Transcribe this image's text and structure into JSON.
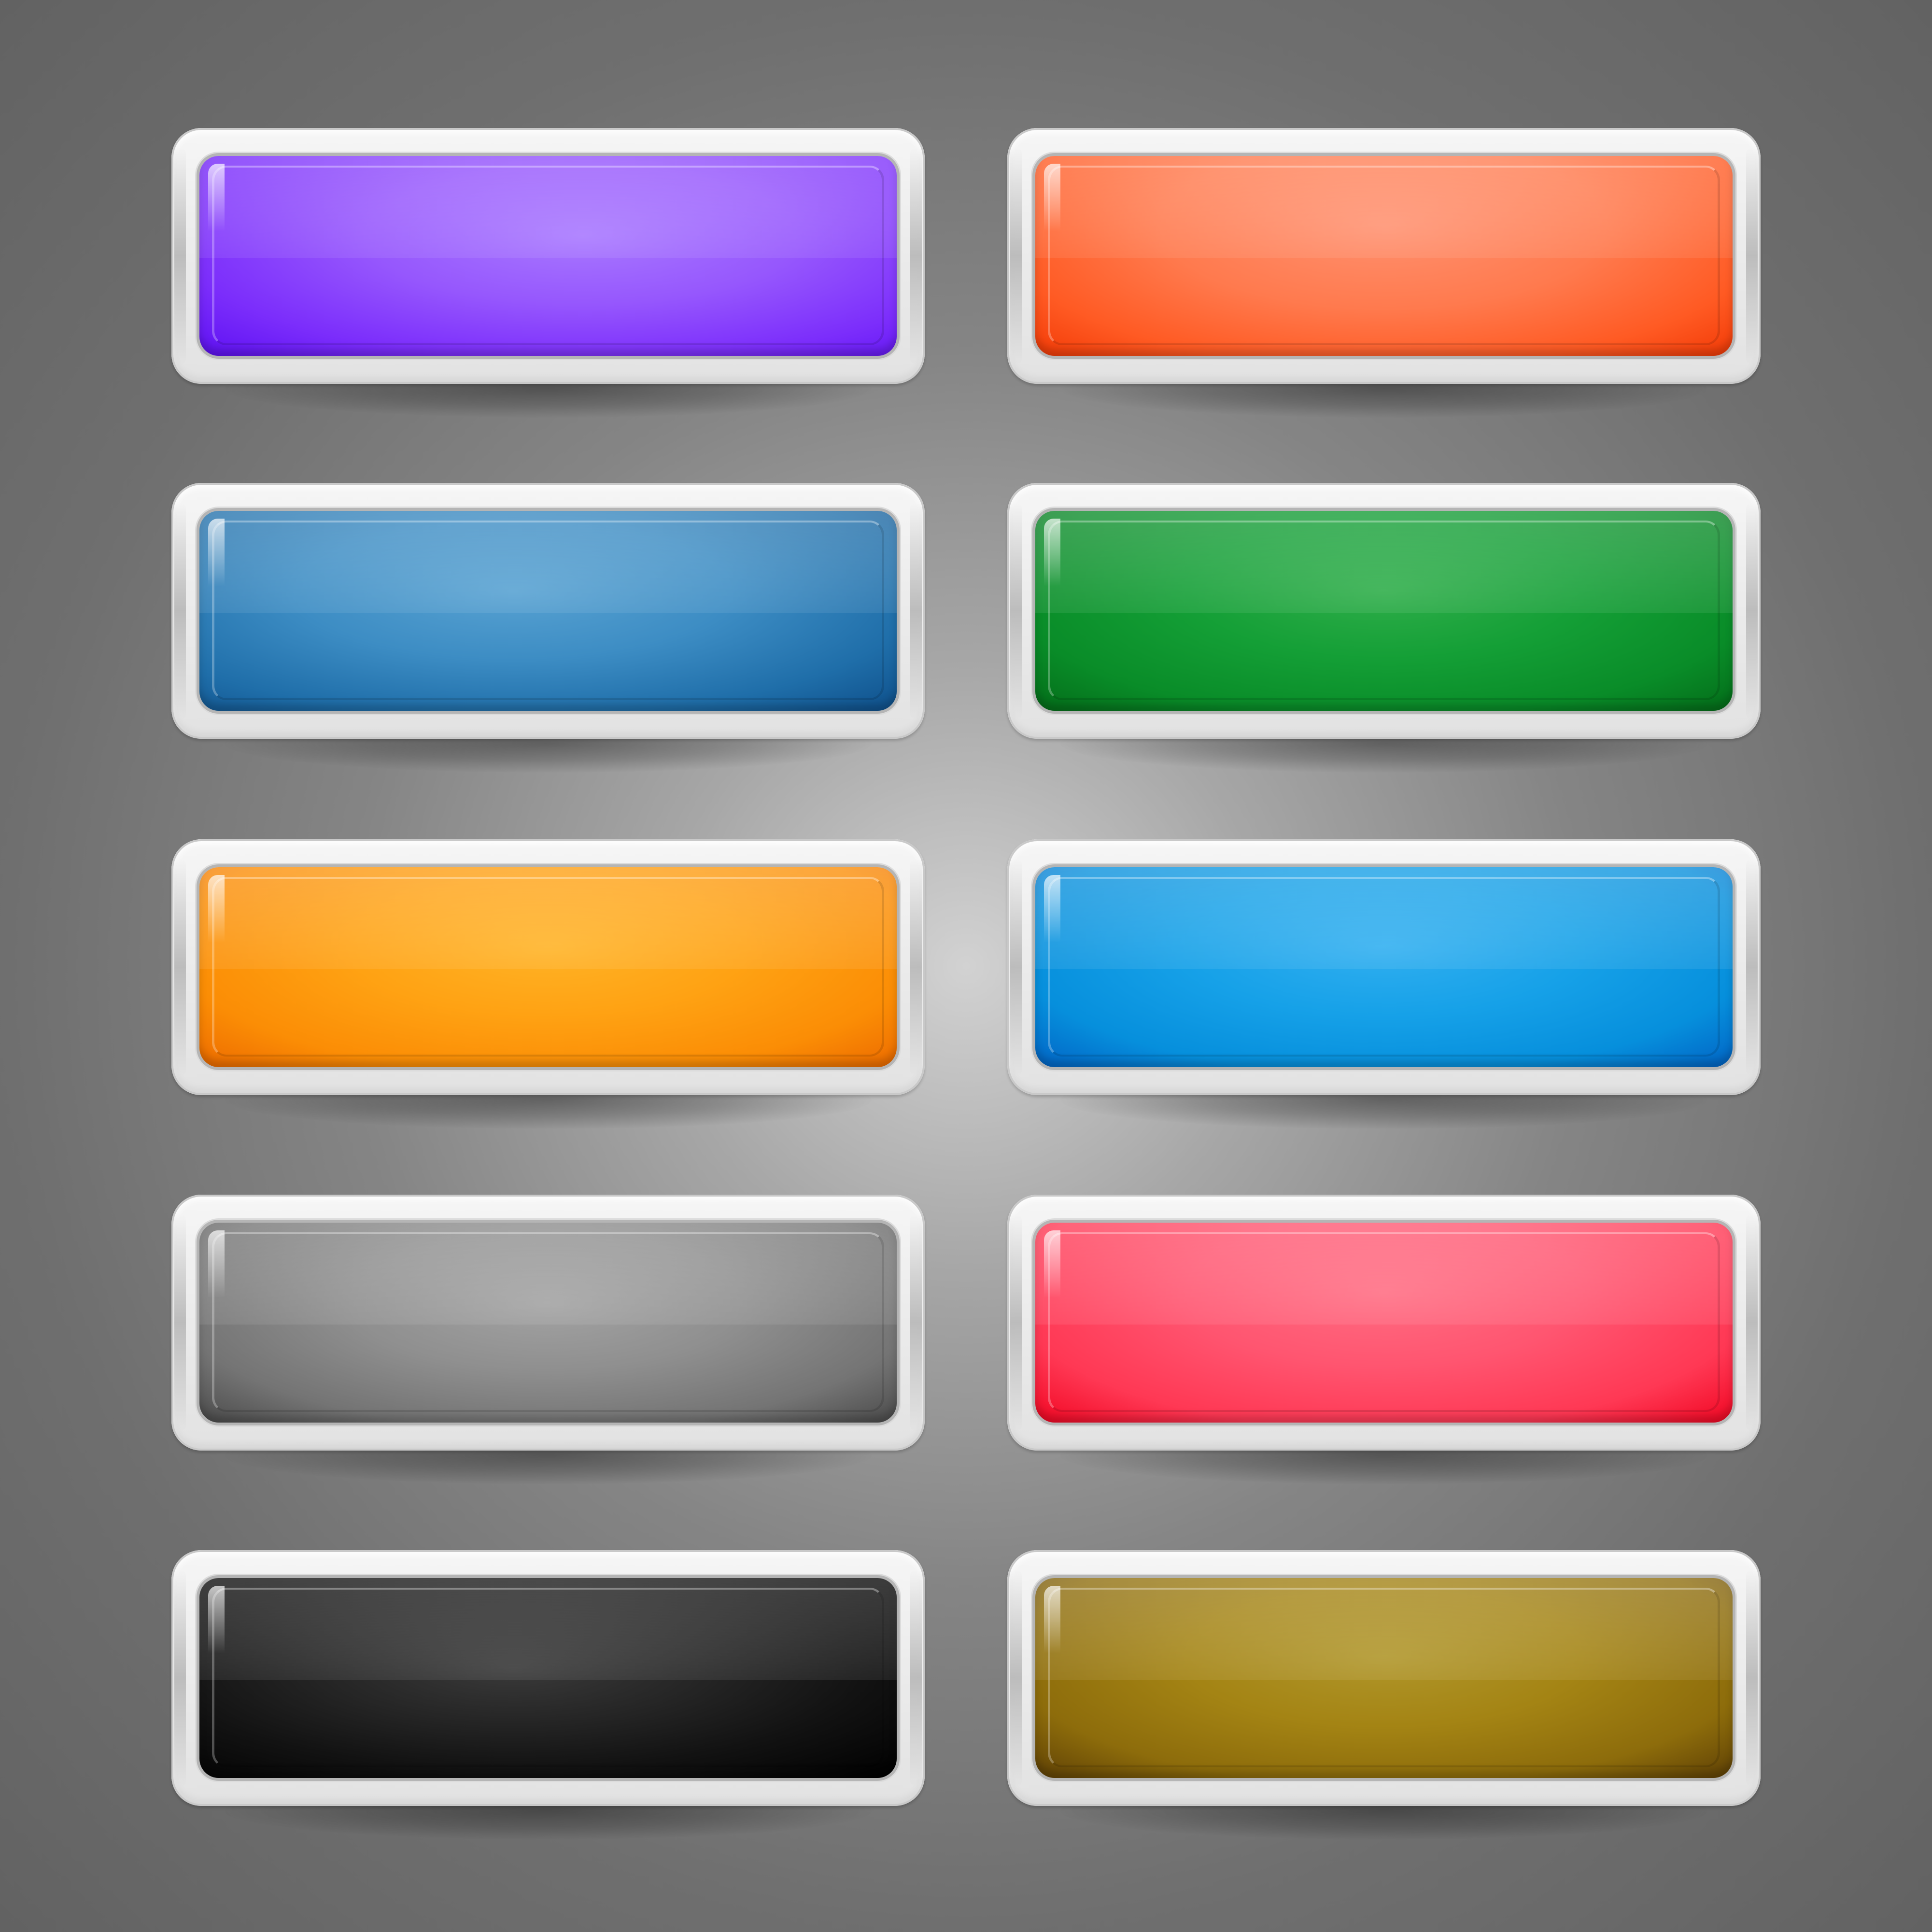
{
  "buttons": [
    {
      "id": "purple",
      "color": "#9657fd"
    },
    {
      "id": "orange",
      "color": "#ff7a4e"
    },
    {
      "id": "blue",
      "color": "#3d8dc4"
    },
    {
      "id": "green",
      "color": "#149f36"
    },
    {
      "id": "amber",
      "color": "#ffa213"
    },
    {
      "id": "sky",
      "color": "#16a1e8"
    },
    {
      "id": "gray",
      "color": "#8f8f8f"
    },
    {
      "id": "red",
      "color": "#ff5570"
    },
    {
      "id": "black",
      "color": "#121212"
    },
    {
      "id": "olive",
      "color": "#a48414"
    }
  ],
  "frame_color": "#ececec",
  "background_color": "#8a8a8a"
}
